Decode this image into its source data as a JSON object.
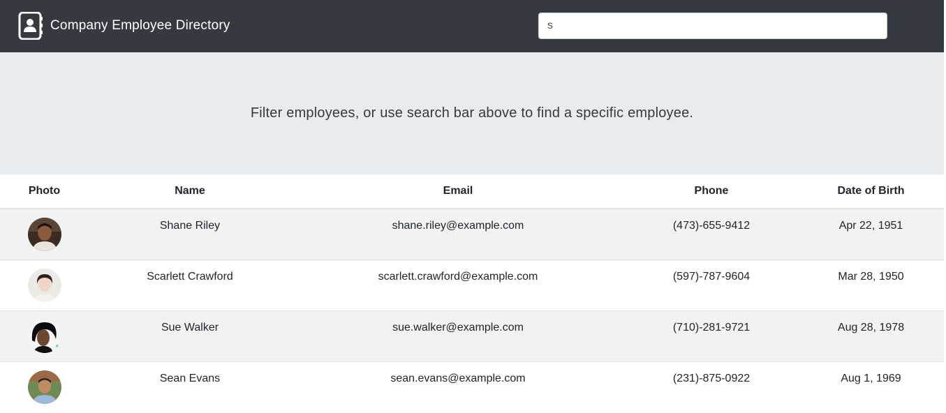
{
  "header": {
    "title": "Company Employee Directory",
    "icon": "address-book-icon"
  },
  "search": {
    "value": "s",
    "placeholder": ""
  },
  "jumbotron": {
    "text": "Filter employees, or use search bar above to find a specific employee."
  },
  "table": {
    "columns": [
      "Photo",
      "Name",
      "Email",
      "Phone",
      "Date of Birth"
    ],
    "rows": [
      {
        "name": "Shane Riley",
        "email": "shane.riley@example.com",
        "phone": "(473)-655-9412",
        "dob": "Apr 22, 1951"
      },
      {
        "name": "Scarlett Crawford",
        "email": "scarlett.crawford@example.com",
        "phone": "(597)-787-9604",
        "dob": "Mar 28, 1950"
      },
      {
        "name": "Sue Walker",
        "email": "sue.walker@example.com",
        "phone": "(710)-281-9721",
        "dob": "Aug 28, 1978"
      },
      {
        "name": "Sean Evans",
        "email": "sean.evans@example.com",
        "phone": "(231)-875-0922",
        "dob": "Aug 1, 1969"
      }
    ]
  },
  "colors": {
    "navbar": "#343a40",
    "jumbotron": "#e9ecef",
    "stripe": "#f2f2f2"
  }
}
